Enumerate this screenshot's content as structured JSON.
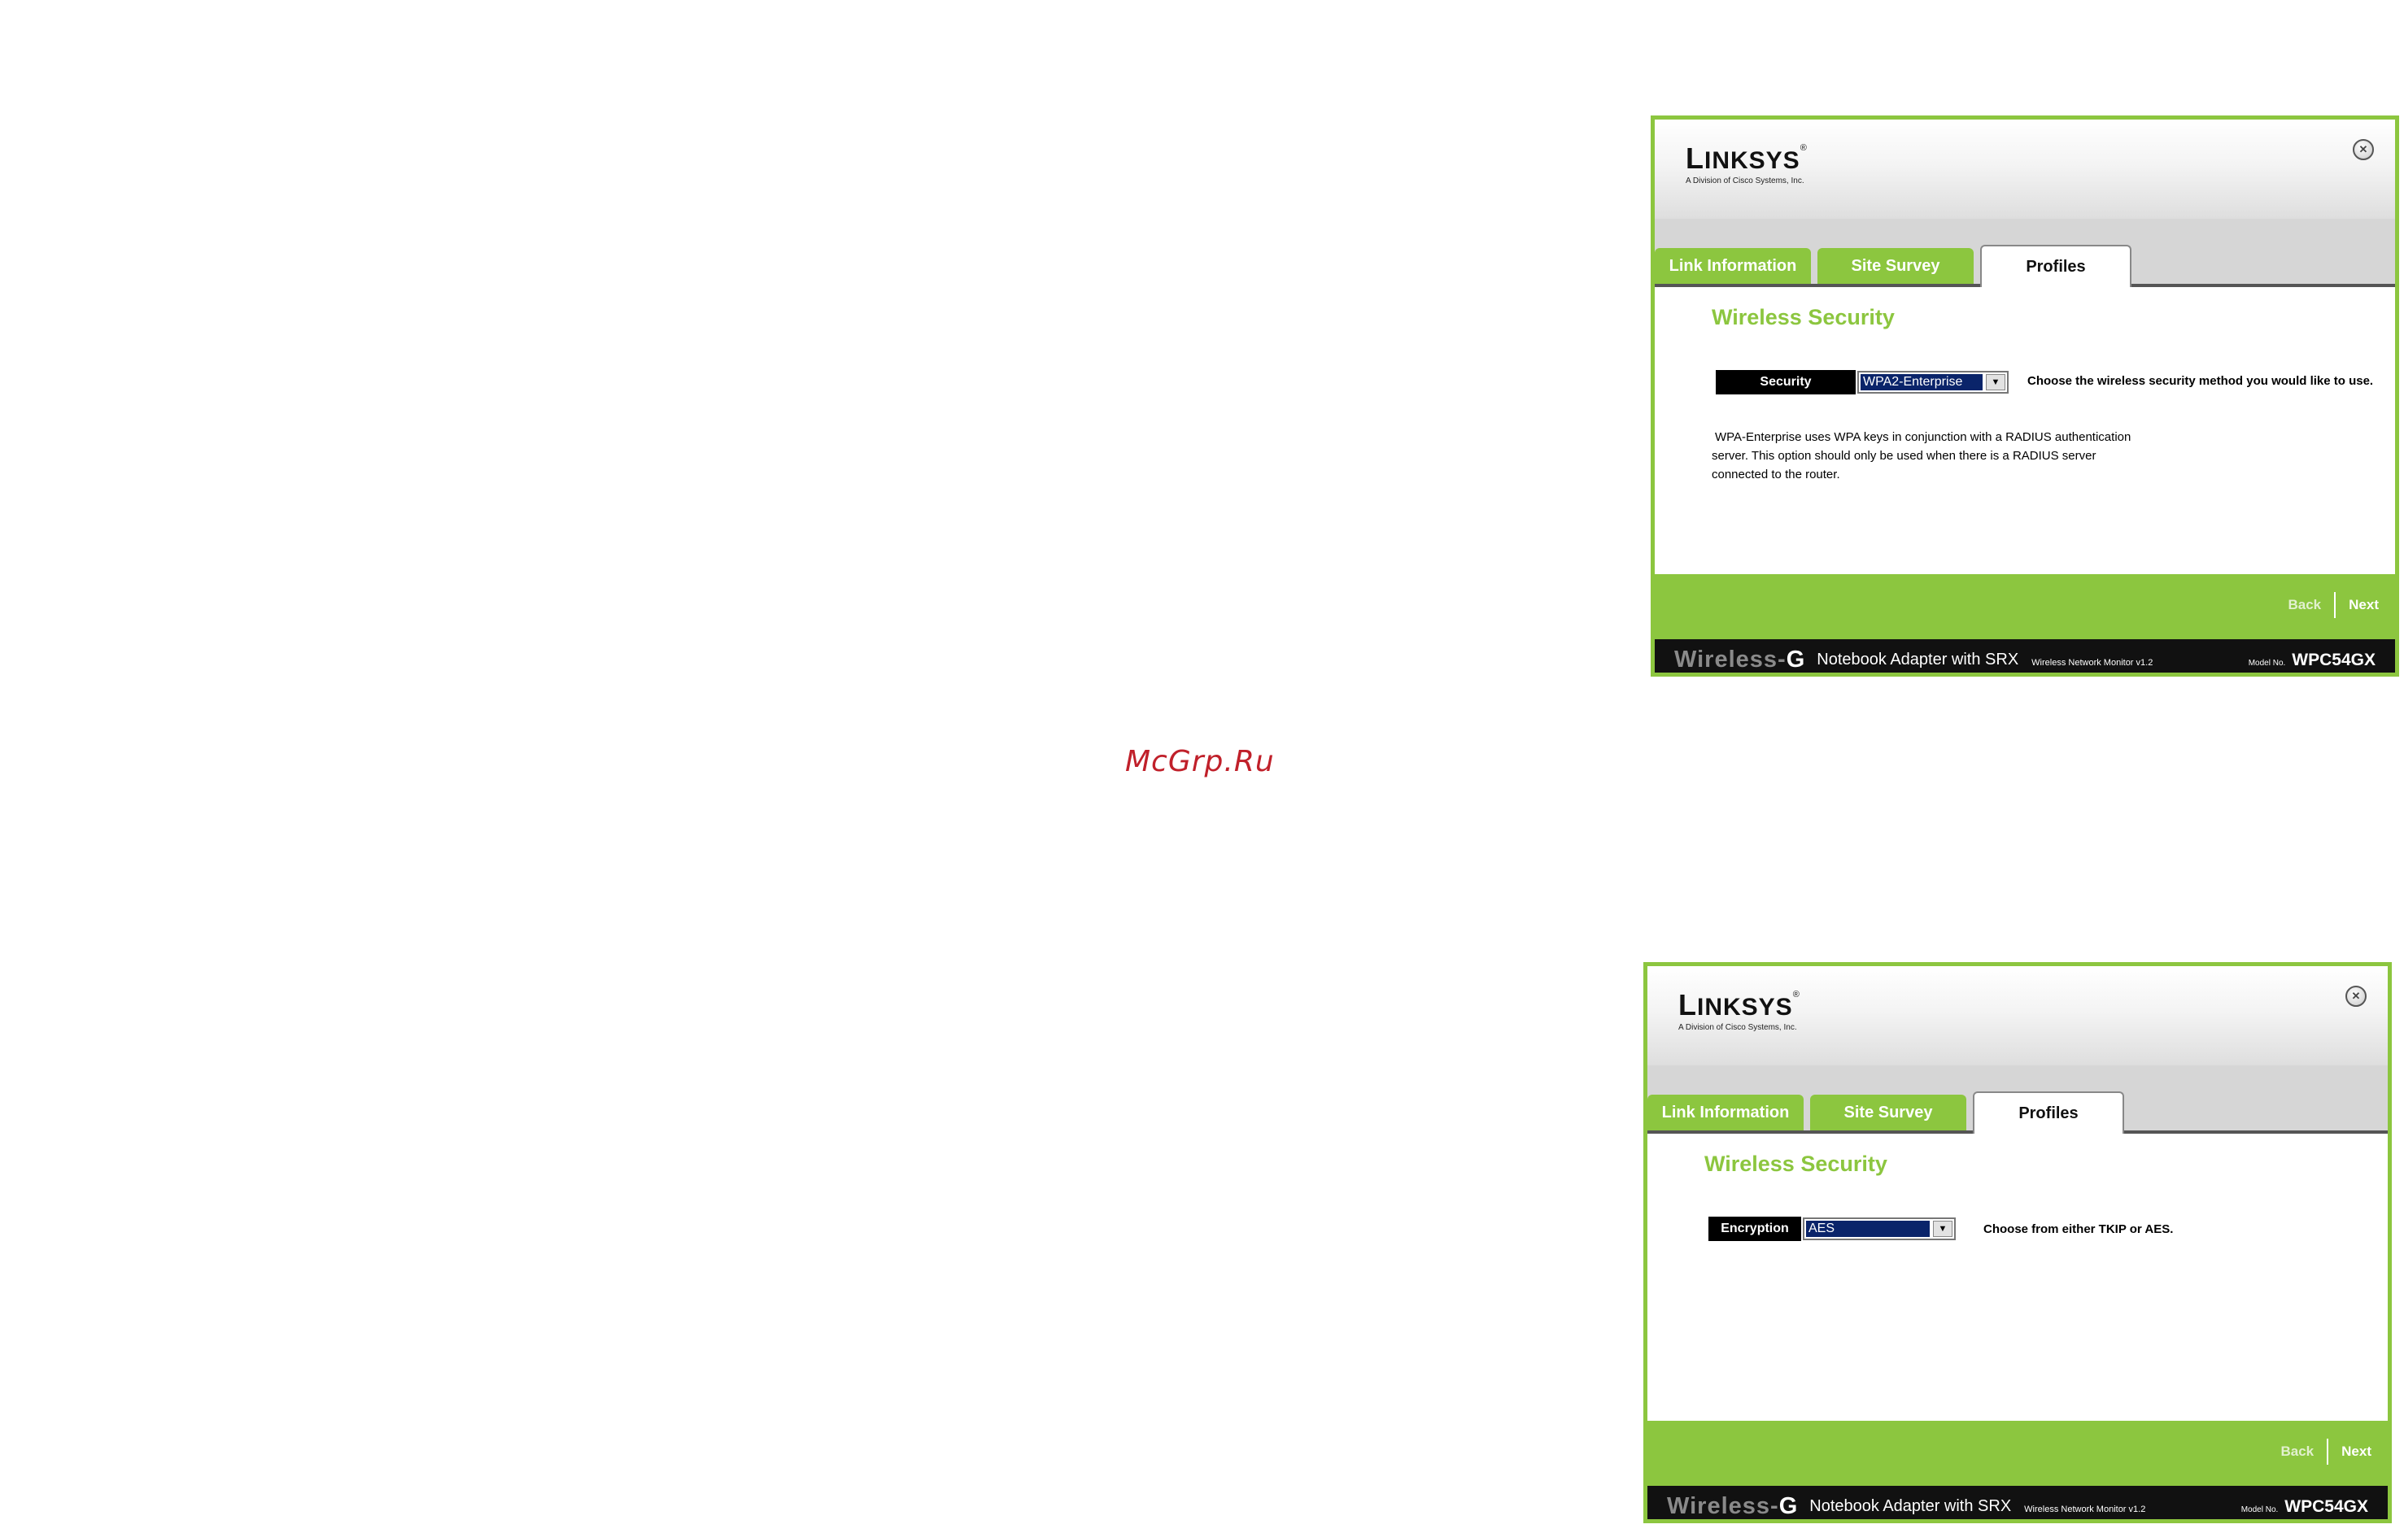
{
  "watermark": "McGrp.Ru",
  "windows": [
    {
      "logo": {
        "main_first": "L",
        "main_rest": "INKSYS",
        "registered": "®",
        "sub": "A Division of Cisco Systems, Inc."
      },
      "tabs": [
        "Link Information",
        "Site Survey",
        "Profiles"
      ],
      "active_tab": "Profiles",
      "section_title": "Wireless Security",
      "field_label": "Security",
      "select_value": "WPA2-Enterprise",
      "hint": "Choose the wireless security method you would like to use.",
      "description_lines": [
        "WPA-Enterprise uses WPA keys in conjunction with a RADIUS authentication",
        "server.  This option should only be used when there is a RADIUS server",
        "connected to the router."
      ],
      "nav": {
        "back": "Back",
        "next": "Next"
      },
      "footer": {
        "brand_word": "Wireless-",
        "brand_g": "G",
        "product": "Notebook Adapter with SRX",
        "monitor": "Wireless Network Monitor v1.2",
        "model_label": "Model No.",
        "model_value": "WPC54GX"
      }
    },
    {
      "logo": {
        "main_first": "L",
        "main_rest": "INKSYS",
        "registered": "®",
        "sub": "A Division of Cisco Systems, Inc."
      },
      "tabs": [
        "Link Information",
        "Site Survey",
        "Profiles"
      ],
      "active_tab": "Profiles",
      "section_title": "Wireless Security",
      "field_label": "Encryption",
      "select_value": "AES",
      "hint": "Choose from either TKIP or AES.",
      "nav": {
        "back": "Back",
        "next": "Next"
      },
      "footer": {
        "brand_word": "Wireless-",
        "brand_g": "G",
        "product": "Notebook Adapter with SRX",
        "monitor": "Wireless Network Monitor v1.2",
        "model_label": "Model No.",
        "model_value": "WPC54GX"
      }
    }
  ],
  "colors": {
    "accent_green": "#8cc63f",
    "selection_blue": "#0a246a",
    "footer_black": "#111111"
  }
}
